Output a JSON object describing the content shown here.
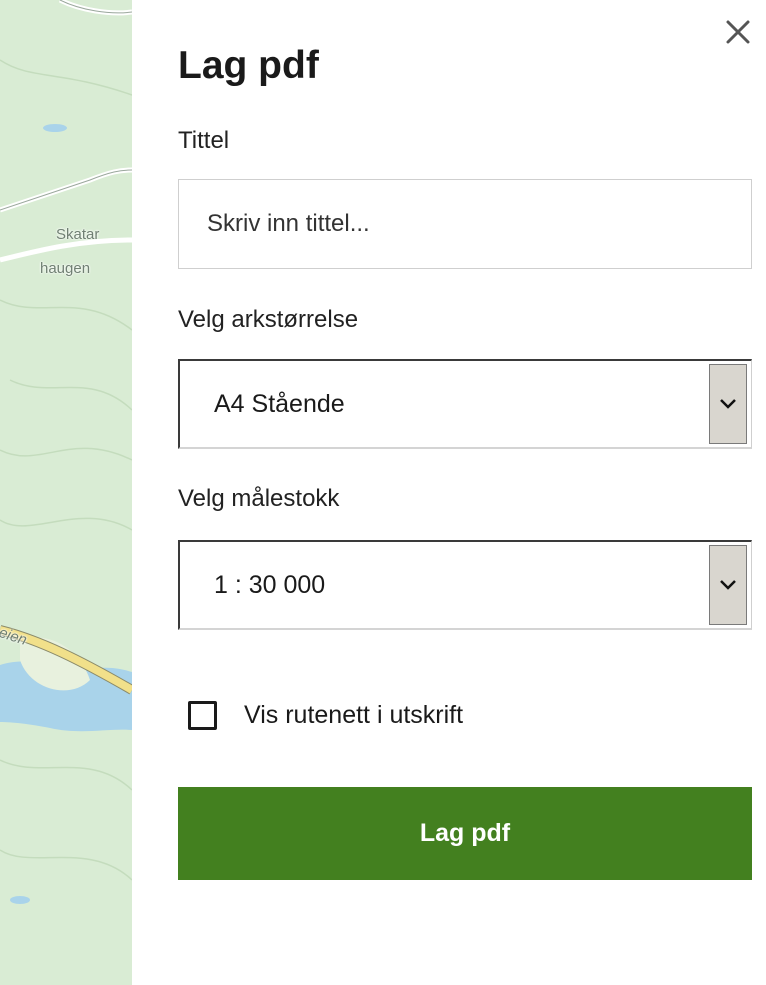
{
  "map": {
    "labels": [
      "Skatar",
      "haugen",
      "eien"
    ]
  },
  "dialog": {
    "close_icon": "close-icon",
    "title": "Lag pdf",
    "title_field": {
      "label": "Tittel",
      "value": "",
      "placeholder": "Skriv inn tittel..."
    },
    "paper_size": {
      "label": "Velg arkstørrelse",
      "selected": "A4 Stående",
      "icon": "chevron-down-icon"
    },
    "scale": {
      "label": "Velg målestokk",
      "selected": "1 : 30 000",
      "icon": "chevron-down-icon"
    },
    "grid_checkbox": {
      "label": "Vis rutenett i utskrift",
      "checked": false
    },
    "submit_label": "Lag pdf"
  },
  "colors": {
    "accent": "#43801f",
    "map_land": "#d9ecd4",
    "map_water": "#a9d3ea",
    "map_road": "#f1e08a"
  }
}
